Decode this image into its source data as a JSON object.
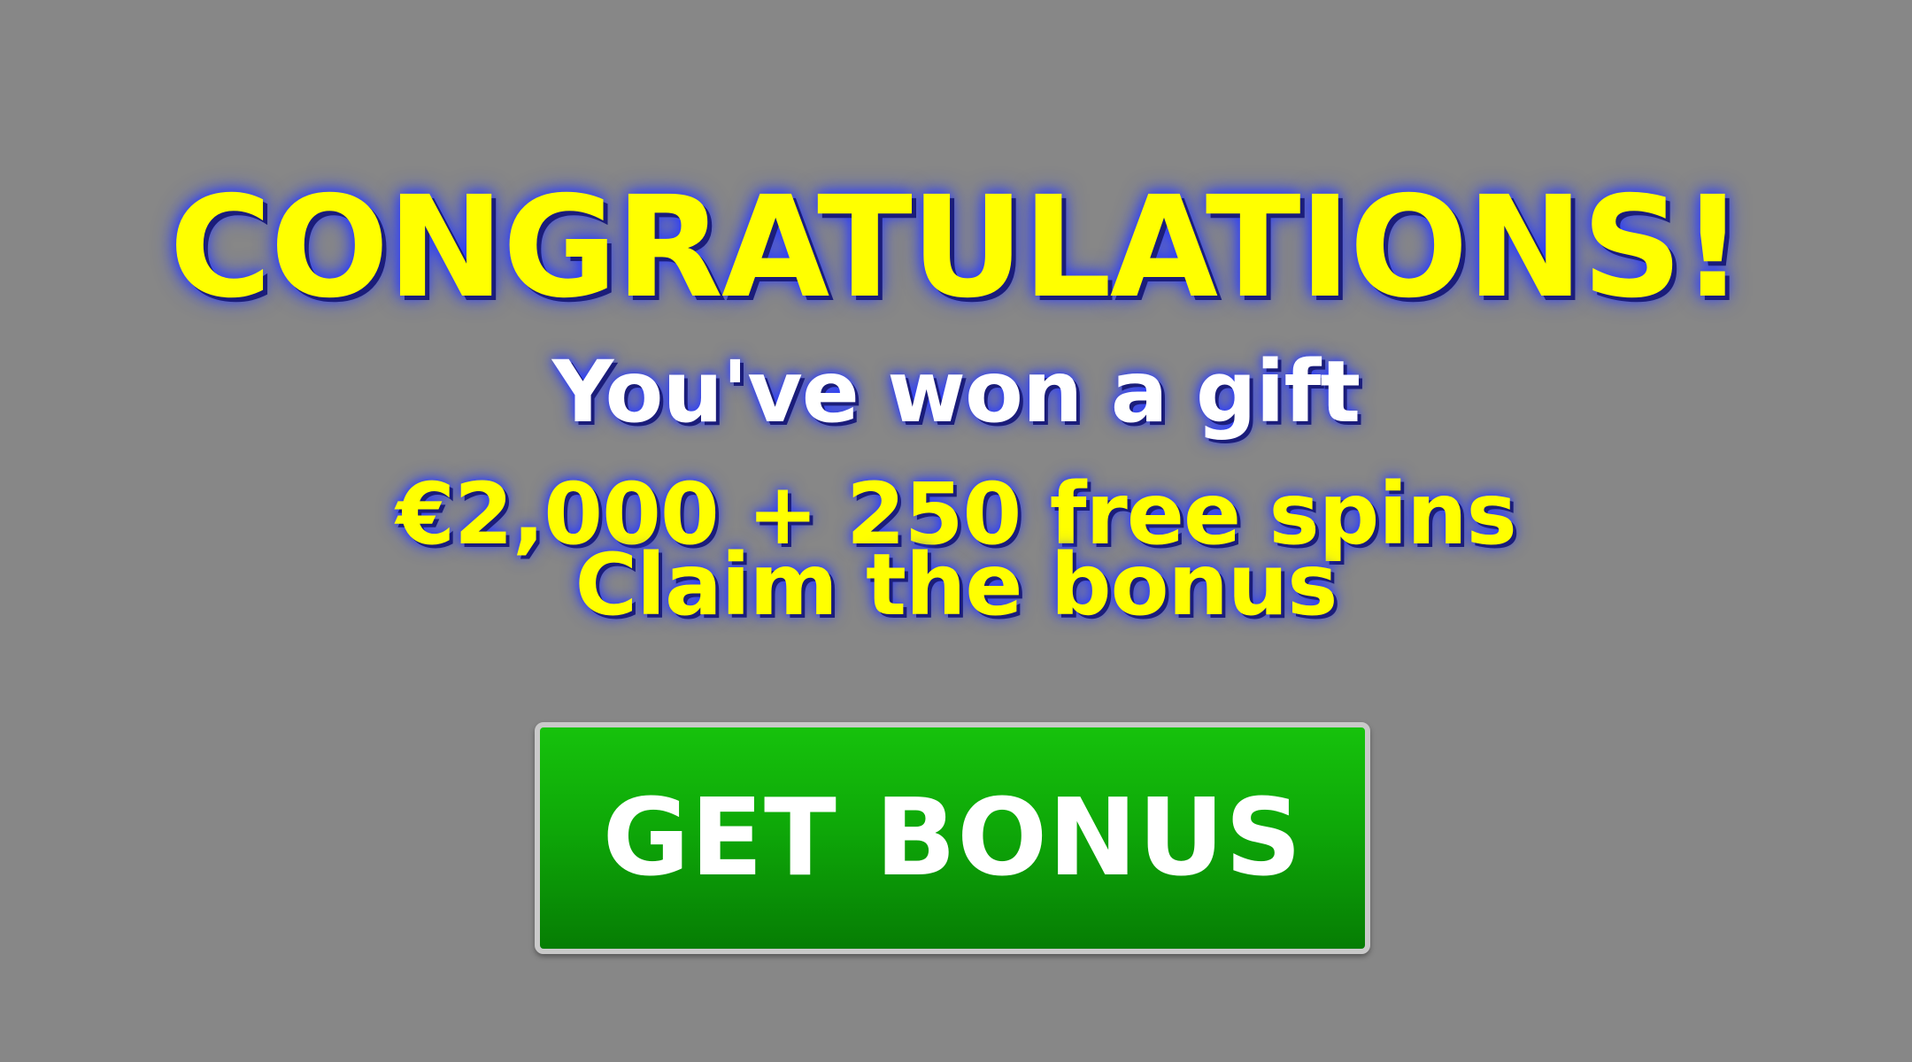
{
  "headline": "CONGRATULATIONS!",
  "gift_line": "You've won a gift",
  "prize_line": "€2,000 + 250 free spins",
  "claim_line": "Claim the bonus",
  "button": {
    "label": "GET BONUS"
  },
  "colors": {
    "background": "#878787",
    "headline": "#ffff00",
    "gift_text": "#ffffff",
    "glow": "#2a3cff",
    "button": "#0ea808"
  }
}
